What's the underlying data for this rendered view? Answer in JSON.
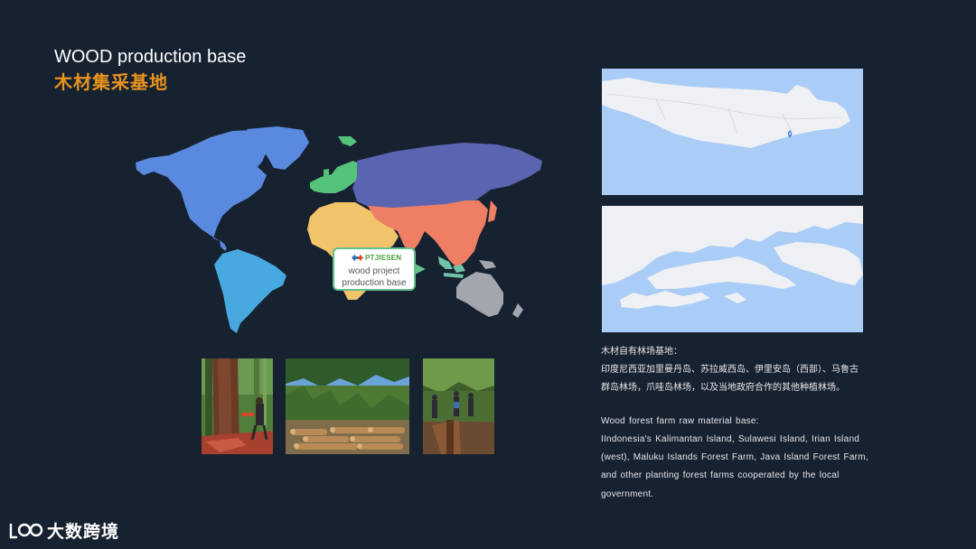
{
  "title": {
    "en": "WOOD production base",
    "cn": "木材集采基地"
  },
  "map_callout": {
    "logo": "PTJIESEN",
    "line1": "wood project",
    "line2": "production base"
  },
  "colors": {
    "background": "#172231",
    "title_accent": "#e8941f",
    "callout_border": "#63c08a",
    "north_america": "#5a8ae0",
    "south_america": "#48a9e0",
    "europe": "#55c27a",
    "russia": "#5a64b0",
    "africa": "#f2c46a",
    "asia": "#ee7f64",
    "oceania": "#a3a6ad",
    "map_water": "#a9cdf6",
    "map_land": "#eef0f4"
  },
  "description": {
    "cn_line1": "木材自有林场基地：",
    "cn_line2": "印度尼西亚加里曼丹岛、苏拉威西岛、伊里安岛（西部）、马鲁古",
    "cn_line3": "群岛林场，爪哇岛林场，以及当地政府合作的其他种植林场。",
    "en_line1": "Wood forest farm raw material base:",
    "en_line2": "IIndonesia's Kalimantan Island, Sulawesi Island, Irian Island",
    "en_line3": "(west), Maluku Islands Forest Farm, Java Island Forest Farm,",
    "en_line4": "and other planting forest farms cooperated by the local",
    "en_line5": "government."
  },
  "brand": {
    "name": "大数跨境"
  }
}
